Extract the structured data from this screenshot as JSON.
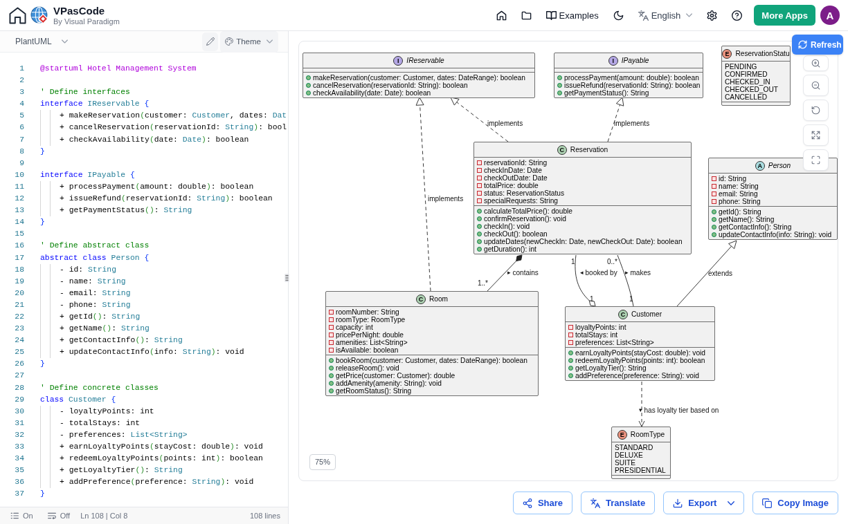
{
  "top_bar": {
    "app_name": "VPasCode",
    "app_tagline": "By Visual Paradigm",
    "examples": "Examples",
    "language": "English",
    "more_apps": "More Apps",
    "avatar_initial": "A"
  },
  "editor": {
    "language": "PlantUML",
    "theme": "Theme",
    "lines": [
      {
        "number": "1",
        "tokens": [
          {
            "kind": "directive",
            "text": "@startuml Hotel Management System"
          }
        ]
      },
      {
        "number": "2"
      },
      {
        "number": "3",
        "tokens": [
          {
            "kind": "comment",
            "text": "' Define interfaces"
          }
        ]
      },
      {
        "number": "4",
        "tokens": [
          {
            "kind": "keyword",
            "text": "interface "
          },
          {
            "kind": "type",
            "text": "IReservable "
          },
          {
            "kind": "brace",
            "text": "{"
          }
        ],
        "children": [
          {
            "number": "5",
            "tokens": [
              {
                "kind": "plain",
                "text": "+ makeReservation"
              },
              {
                "kind": "paren",
                "text": "("
              },
              {
                "kind": "plain",
                "text": "customer: "
              },
              {
                "kind": "type",
                "text": "Customer"
              },
              {
                "kind": "plain",
                "text": ", dates: "
              },
              {
                "kind": "type",
                "text": "Dat"
              }
            ]
          },
          {
            "number": "6",
            "tokens": [
              {
                "kind": "plain",
                "text": "+ cancelReservation"
              },
              {
                "kind": "paren",
                "text": "("
              },
              {
                "kind": "plain",
                "text": "reservationId: "
              },
              {
                "kind": "type",
                "text": "String"
              },
              {
                "kind": "paren",
                "text": ")"
              },
              {
                "kind": "plain",
                "text": ": bool"
              }
            ]
          },
          {
            "number": "7",
            "tokens": [
              {
                "kind": "plain",
                "text": "+ checkAvailability"
              },
              {
                "kind": "paren",
                "text": "("
              },
              {
                "kind": "plain",
                "text": "date: "
              },
              {
                "kind": "type",
                "text": "Date"
              },
              {
                "kind": "paren",
                "text": ")"
              },
              {
                "kind": "plain",
                "text": ": boolean"
              }
            ]
          }
        ]
      },
      {
        "number": "8",
        "tokens": [
          {
            "kind": "brace",
            "text": "}"
          }
        ]
      },
      {
        "number": "9"
      },
      {
        "number": "10",
        "tokens": [
          {
            "kind": "keyword",
            "text": "interface "
          },
          {
            "kind": "type",
            "text": "IPayable "
          },
          {
            "kind": "brace",
            "text": "{"
          }
        ],
        "children": [
          {
            "number": "11",
            "tokens": [
              {
                "kind": "plain",
                "text": "+ processPayment"
              },
              {
                "kind": "paren",
                "text": "("
              },
              {
                "kind": "plain",
                "text": "amount: double"
              },
              {
                "kind": "paren",
                "text": ")"
              },
              {
                "kind": "plain",
                "text": ": boolean"
              }
            ]
          },
          {
            "number": "12",
            "tokens": [
              {
                "kind": "plain",
                "text": "+ issueRefund"
              },
              {
                "kind": "paren",
                "text": "("
              },
              {
                "kind": "plain",
                "text": "reservationId: "
              },
              {
                "kind": "type",
                "text": "String"
              },
              {
                "kind": "paren",
                "text": ")"
              },
              {
                "kind": "plain",
                "text": ": boolean"
              }
            ]
          },
          {
            "number": "13",
            "tokens": [
              {
                "kind": "plain",
                "text": "+ getPaymentStatus"
              },
              {
                "kind": "paren",
                "text": "()"
              },
              {
                "kind": "plain",
                "text": ": "
              },
              {
                "kind": "type",
                "text": "String"
              }
            ]
          }
        ]
      },
      {
        "number": "14",
        "tokens": [
          {
            "kind": "brace",
            "text": "}"
          }
        ]
      },
      {
        "number": "15"
      },
      {
        "number": "16",
        "tokens": [
          {
            "kind": "comment",
            "text": "' Define abstract class"
          }
        ]
      },
      {
        "number": "17",
        "tokens": [
          {
            "kind": "keyword",
            "text": "abstract class "
          },
          {
            "kind": "type",
            "text": "Person "
          },
          {
            "kind": "brace",
            "text": "{"
          }
        ],
        "children": [
          {
            "number": "18",
            "tokens": [
              {
                "kind": "plain",
                "text": "- id: "
              },
              {
                "kind": "type",
                "text": "String"
              }
            ]
          },
          {
            "number": "19",
            "tokens": [
              {
                "kind": "plain",
                "text": "- name: "
              },
              {
                "kind": "type",
                "text": "String"
              }
            ]
          },
          {
            "number": "20",
            "tokens": [
              {
                "kind": "plain",
                "text": "- email: "
              },
              {
                "kind": "type",
                "text": "String"
              }
            ]
          },
          {
            "number": "21",
            "tokens": [
              {
                "kind": "plain",
                "text": "- phone: "
              },
              {
                "kind": "type",
                "text": "String"
              }
            ]
          },
          {
            "number": "22",
            "tokens": [
              {
                "kind": "plain",
                "text": "+ getId"
              },
              {
                "kind": "paren",
                "text": "()"
              },
              {
                "kind": "plain",
                "text": ": "
              },
              {
                "kind": "type",
                "text": "String"
              }
            ]
          },
          {
            "number": "23",
            "tokens": [
              {
                "kind": "plain",
                "text": "+ getName"
              },
              {
                "kind": "paren",
                "text": "()"
              },
              {
                "kind": "plain",
                "text": ": "
              },
              {
                "kind": "type",
                "text": "String"
              }
            ]
          },
          {
            "number": "24",
            "tokens": [
              {
                "kind": "plain",
                "text": "+ getContactInfo"
              },
              {
                "kind": "paren",
                "text": "()"
              },
              {
                "kind": "plain",
                "text": ": "
              },
              {
                "kind": "type",
                "text": "String"
              }
            ]
          },
          {
            "number": "25",
            "tokens": [
              {
                "kind": "plain",
                "text": "+ updateContactInfo"
              },
              {
                "kind": "paren",
                "text": "("
              },
              {
                "kind": "plain",
                "text": "info: "
              },
              {
                "kind": "type",
                "text": "String"
              },
              {
                "kind": "paren",
                "text": ")"
              },
              {
                "kind": "plain",
                "text": ": void"
              }
            ]
          }
        ]
      },
      {
        "number": "26",
        "tokens": [
          {
            "kind": "brace",
            "text": "}"
          }
        ]
      },
      {
        "number": "27"
      },
      {
        "number": "28",
        "tokens": [
          {
            "kind": "comment",
            "text": "' Define concrete classes"
          }
        ]
      },
      {
        "number": "29",
        "tokens": [
          {
            "kind": "keyword",
            "text": "class "
          },
          {
            "kind": "type",
            "text": "Customer "
          },
          {
            "kind": "brace",
            "text": "{"
          }
        ],
        "children": [
          {
            "number": "30",
            "tokens": [
              {
                "kind": "plain",
                "text": "- loyaltyPoints: int"
              }
            ]
          },
          {
            "number": "31",
            "tokens": [
              {
                "kind": "plain",
                "text": "- totalStays: int"
              }
            ]
          },
          {
            "number": "32",
            "tokens": [
              {
                "kind": "plain",
                "text": "- preferences: "
              },
              {
                "kind": "type",
                "text": "List<String>"
              }
            ]
          },
          {
            "number": "33",
            "tokens": [
              {
                "kind": "plain",
                "text": "+ earnLoyaltyPoints"
              },
              {
                "kind": "paren",
                "text": "("
              },
              {
                "kind": "plain",
                "text": "stayCost: double"
              },
              {
                "kind": "paren",
                "text": ")"
              },
              {
                "kind": "plain",
                "text": ": void"
              }
            ]
          },
          {
            "number": "34",
            "tokens": [
              {
                "kind": "plain",
                "text": "+ redeemLoyaltyPoints"
              },
              {
                "kind": "paren",
                "text": "("
              },
              {
                "kind": "plain",
                "text": "points: int"
              },
              {
                "kind": "paren",
                "text": ")"
              },
              {
                "kind": "plain",
                "text": ": boolean"
              }
            ]
          },
          {
            "number": "35",
            "tokens": [
              {
                "kind": "plain",
                "text": "+ getLoyaltyTier"
              },
              {
                "kind": "paren",
                "text": "()"
              },
              {
                "kind": "plain",
                "text": ": "
              },
              {
                "kind": "type",
                "text": "String"
              }
            ]
          },
          {
            "number": "36",
            "tokens": [
              {
                "kind": "plain",
                "text": "+ addPreference"
              },
              {
                "kind": "paren",
                "text": "("
              },
              {
                "kind": "plain",
                "text": "preference: "
              },
              {
                "kind": "type",
                "text": "String"
              },
              {
                "kind": "paren",
                "text": ")"
              },
              {
                "kind": "plain",
                "text": ": void"
              }
            ]
          }
        ]
      },
      {
        "number": "37",
        "tokens": [
          {
            "kind": "brace",
            "text": "}"
          }
        ]
      }
    ]
  },
  "status_bar": {
    "line_numbers": "On",
    "word_wrap": "Off",
    "cursor": "Ln 108 | Col 8",
    "line_count": "108 lines"
  },
  "preview": {
    "refresh": "Refresh",
    "zoom": "75%",
    "diagram": {
      "classes": [
        {
          "kind": "interface",
          "badge": "I",
          "name": "IReservable",
          "methods": [
            {
              "private": false,
              "text": "makeReservation(customer: Customer, dates: DateRange): boolean"
            },
            {
              "private": false,
              "text": "cancelReservation(reservationId: String): boolean"
            },
            {
              "private": false,
              "text": "checkAvailability(date: Date): boolean"
            }
          ]
        },
        {
          "kind": "interface",
          "badge": "I",
          "name": "IPayable",
          "methods": [
            {
              "private": false,
              "text": "processPayment(amount: double): boolean"
            },
            {
              "private": false,
              "text": "issueRefund(reservationId: String): boolean"
            },
            {
              "private": false,
              "text": "getPaymentStatus(): String"
            }
          ]
        },
        {
          "kind": "enum",
          "badge": "E",
          "name": "ReservationStatu",
          "values": [
            "PENDING",
            "CONFIRMED",
            "CHECKED_IN",
            "CHECKED_OUT",
            "CANCELLED"
          ]
        },
        {
          "kind": "class",
          "badge": "C",
          "name": "Reservation",
          "attributes": [
            {
              "private": true,
              "text": "reservationId: String"
            },
            {
              "private": true,
              "text": "checkInDate: Date"
            },
            {
              "private": true,
              "text": "checkOutDate: Date"
            },
            {
              "private": true,
              "text": "totalPrice: double"
            },
            {
              "private": true,
              "text": "status: ReservationStatus"
            },
            {
              "private": true,
              "text": "specialRequests: String"
            }
          ],
          "methods": [
            {
              "private": false,
              "text": "calculateTotalPrice(): double"
            },
            {
              "private": false,
              "text": "confirmReservation(): void"
            },
            {
              "private": false,
              "text": "checkIn(): void"
            },
            {
              "private": false,
              "text": "checkOut(): boolean"
            },
            {
              "private": false,
              "text": "updateDates(newCheckIn: Date, newCheckOut: Date): boolean"
            },
            {
              "private": false,
              "text": "getDuration(): int"
            }
          ]
        },
        {
          "kind": "abstract",
          "badge": "A",
          "name": "Person",
          "attributes": [
            {
              "private": true,
              "text": "id: String"
            },
            {
              "private": true,
              "text": "name: String"
            },
            {
              "private": true,
              "text": "email: String"
            },
            {
              "private": true,
              "text": "phone: String"
            }
          ],
          "methods": [
            {
              "private": false,
              "text": "getId(): String"
            },
            {
              "private": false,
              "text": "getName(): String"
            },
            {
              "private": false,
              "text": "getContactInfo(): String"
            },
            {
              "private": false,
              "text": "updateContactInfo(info: String): void"
            }
          ]
        },
        {
          "kind": "class",
          "badge": "C",
          "name": "Room",
          "attributes": [
            {
              "private": true,
              "text": "roomNumber: String"
            },
            {
              "private": true,
              "text": "roomType: RoomType"
            },
            {
              "private": true,
              "text": "capacity: int"
            },
            {
              "private": true,
              "text": "pricePerNight: double"
            },
            {
              "private": true,
              "text": "amenities: List<String>"
            },
            {
              "private": true,
              "text": "isAvailable: boolean"
            }
          ],
          "methods": [
            {
              "private": false,
              "text": "bookRoom(customer: Customer, dates: DateRange): boolean"
            },
            {
              "private": false,
              "text": "releaseRoom(): void"
            },
            {
              "private": false,
              "text": "getPrice(customer: Customer): double"
            },
            {
              "private": false,
              "text": "addAmenity(amenity: String): void"
            },
            {
              "private": false,
              "text": "getRoomStatus(): String"
            }
          ]
        },
        {
          "kind": "class",
          "badge": "C",
          "name": "Customer",
          "attributes": [
            {
              "private": true,
              "text": "loyaltyPoints: int"
            },
            {
              "private": true,
              "text": "totalStays: int"
            },
            {
              "private": true,
              "text": "preferences: List<String>"
            }
          ],
          "methods": [
            {
              "private": false,
              "text": "earnLoyaltyPoints(stayCost: double): void"
            },
            {
              "private": false,
              "text": "redeemLoyaltyPoints(points: int): boolean"
            },
            {
              "private": false,
              "text": "getLoyaltyTier(): String"
            },
            {
              "private": false,
              "text": "addPreference(preference: String): void"
            }
          ]
        },
        {
          "kind": "enum",
          "badge": "E",
          "name": "RoomType",
          "values": [
            "STANDARD",
            "DELUXE",
            "SUITE",
            "PRESIDENTIAL"
          ]
        }
      ],
      "relations": [
        {
          "kind": "realization",
          "label": "implements"
        },
        {
          "kind": "realization",
          "label": "implements"
        },
        {
          "kind": "realization",
          "label": "implements"
        },
        {
          "kind": "composition",
          "label": "contains",
          "label_arrow": "▸",
          "target_multiplicity": "1..*"
        },
        {
          "kind": "aggregation",
          "label": "booked by",
          "label_arrow": "◂",
          "source_multiplicity": "1",
          "target_multiplicity": "1"
        },
        {
          "kind": "association",
          "label": "makes",
          "label_arrow": "▸",
          "source_multiplicity": "1",
          "target_multiplicity": "0..*"
        },
        {
          "kind": "generalization",
          "label": "extends"
        },
        {
          "kind": "dependency",
          "label": "has loyalty tier based on",
          "label_arrow": "▾"
        }
      ]
    }
  },
  "actions": [
    {
      "kind": "share",
      "label": "Share",
      "has_menu": false
    },
    {
      "kind": "translate",
      "label": "Translate",
      "has_menu": false
    },
    {
      "kind": "export",
      "label": "Export",
      "has_menu": true
    },
    {
      "kind": "copy",
      "label": "Copy Image",
      "has_menu": false
    }
  ]
}
